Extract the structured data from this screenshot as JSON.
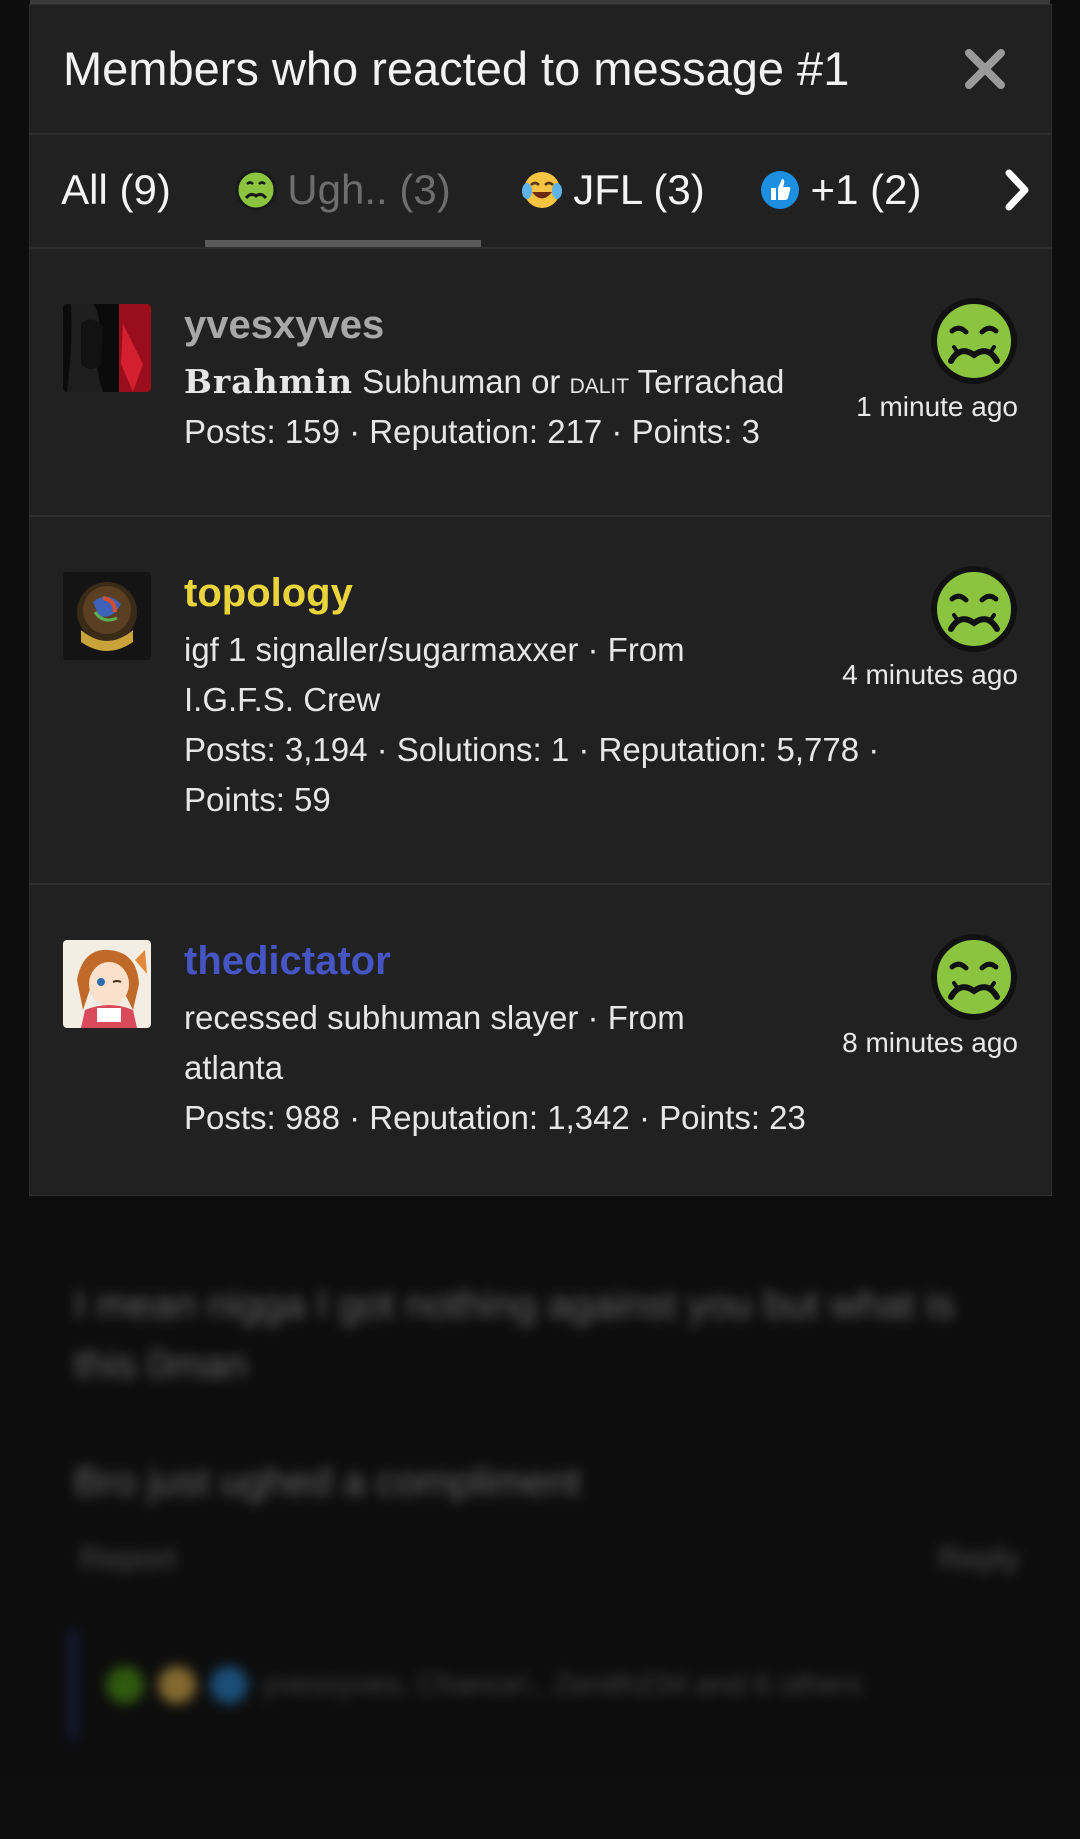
{
  "dialog": {
    "title": "Members who reacted to message #1",
    "close_label": "Close"
  },
  "tabs": [
    {
      "label": "All (9)",
      "icon": null,
      "active": false
    },
    {
      "label": "Ugh.. (3)",
      "icon": "nauseated-face-icon",
      "active": true
    },
    {
      "label": "JFL (3)",
      "icon": "laughing-tears-icon",
      "active": false
    },
    {
      "label": "+1 (2)",
      "icon": "thumbs-up-icon",
      "active": false
    }
  ],
  "members": [
    {
      "name": "yvesxyves",
      "name_color": "#a8a8a8",
      "title_part1": "Brahmin",
      "title_part2": " Subhuman or ",
      "title_part3": "DALIT",
      "title_part4": " Terrachad",
      "stats": "Posts: 159 · Reputation: 217 · Points: 3",
      "time": "1 minute ago",
      "reaction": "nauseated-face-icon"
    },
    {
      "name": "topology",
      "name_color": "#e9d43c",
      "title": "igf 1 signaller/sugarmaxxer · From I.G.F.S. Crew",
      "stats": "Posts: 3,194 · Solutions: 1 · Reputation: 5,778 · Points: 59",
      "time": "4 minutes ago",
      "reaction": "nauseated-face-icon"
    },
    {
      "name": "thedictator",
      "name_color": "#4556c4",
      "title": "recessed subhuman slayer · From atlanta",
      "stats": "Posts: 988 · Reputation: 1,342 · Points: 23",
      "time": "8 minutes ago",
      "reaction": "nauseated-face-icon"
    }
  ],
  "background": {
    "post_line1": "I mean nigga I got nothing against you but what is",
    "post_line2": "this 0man",
    "post_line3": "Bro just ughed a compliment",
    "report_label": "Report",
    "reply_label": "Reply",
    "reactions_summary": "yvesxyves, Chance!., Zenith234 and 6 others"
  },
  "colors": {
    "modal_bg": "#212121",
    "page_bg": "#151515",
    "divider": "#2c2c2c",
    "nauseated_green": "#8bc53f"
  }
}
